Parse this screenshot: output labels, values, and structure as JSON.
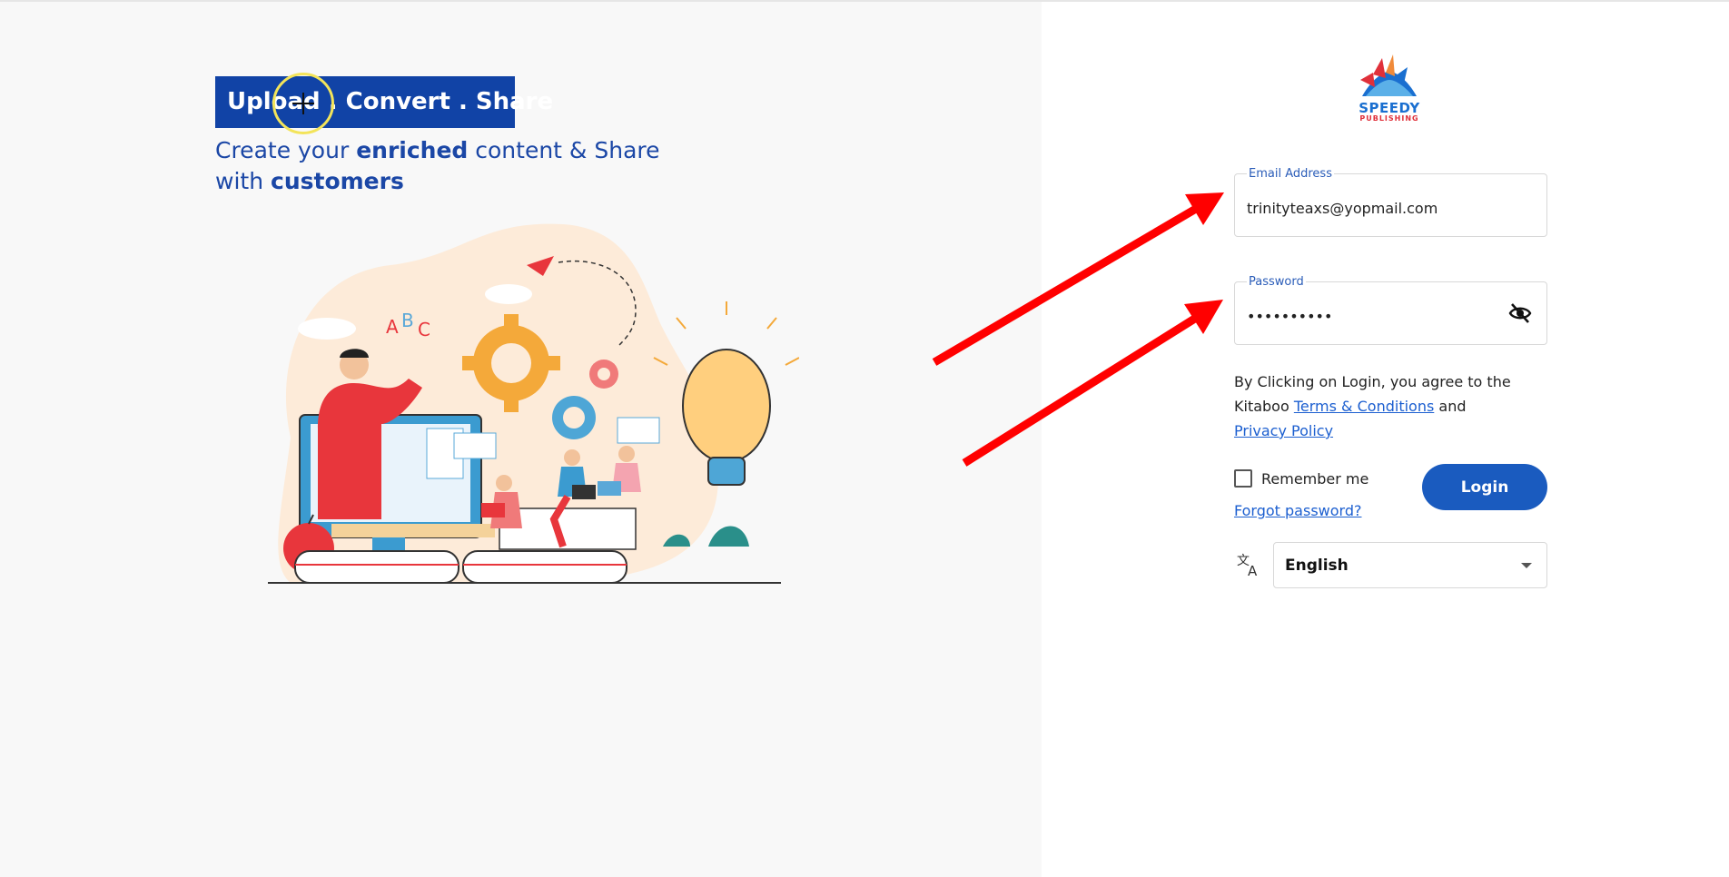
{
  "hero": {
    "title": "Upload . Convert . Share",
    "subtitle_part1": "Create your ",
    "subtitle_bold1": "enriched",
    "subtitle_part2": " content & Share with ",
    "subtitle_bold2": "customers"
  },
  "brand": {
    "line1": "SPEEDY",
    "line2": "PUBLISHING"
  },
  "login_form": {
    "email_label": "Email Address",
    "email_value": "trinityteaxs@yopmail.com",
    "password_label": "Password",
    "password_value": "••••••••••",
    "agreement_prefix": "By Clicking on Login, you agree to the Kitaboo ",
    "terms_link": "Terms & Conditions",
    "agreement_and": " and",
    "privacy_link": "Privacy Policy",
    "remember_label": "Remember me",
    "login_label": "Login",
    "forgot_label": "Forgot password?",
    "language_value": "English"
  },
  "colors": {
    "primary": "#1a5bbf",
    "highlight": "#1143a6",
    "arrow": "#ff0000"
  }
}
